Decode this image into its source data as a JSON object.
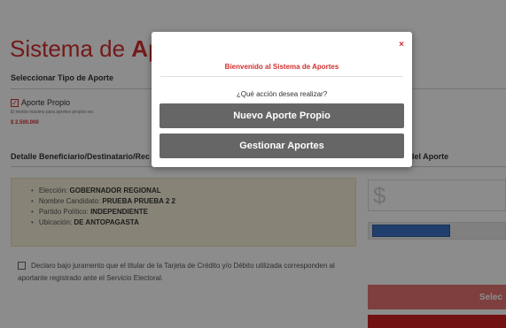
{
  "header": {
    "title_prefix": "Sistema de ",
    "title_bold": "Apor"
  },
  "tipo_aporte": {
    "heading": "Seleccionar Tipo de Aporte",
    "option_label": "Aporte Propio",
    "option_checked": true,
    "hint": "El monto máximo para aportes propios es:",
    "max_amount": "$ 2.500.000"
  },
  "detalle": {
    "heading": "Detalle Beneficiario/Destinatario/Rec",
    "items": [
      {
        "label": "Elección: ",
        "value": "GOBERNADOR REGIONAL"
      },
      {
        "label": "Nombre Candidato: ",
        "value": "PRUEBA PRUEBA 2 2"
      },
      {
        "label": "Partido Político: ",
        "value": "INDEPENDIENTE"
      },
      {
        "label": "Ubicación: ",
        "value": "DE ANTOPAGASTA"
      }
    ]
  },
  "aporte": {
    "heading": "del Aporte",
    "currency_symbol": "$",
    "progress_fraction": 0.6
  },
  "declaracion": {
    "text": "Declaro bajo juramento que el titular de la Tarjeta de Crédito y/o Débito utilizada corresponden al aportante registrado ante el Servicio Electoral."
  },
  "buttons": {
    "select_label": "Selec"
  },
  "modal": {
    "close_label": "×",
    "title": "Bienvenido al Sistema de Aportes",
    "question": "¿Qué acción desea realizar?",
    "btn_nuevo": "Nuevo Aporte Propio",
    "btn_gestionar": "Gestionar Aportes"
  },
  "colors": {
    "accent_red": "#d32f2f",
    "button_gray": "#666666",
    "info_bg": "#f6efd8",
    "progress_blue": "#3d74c7"
  }
}
